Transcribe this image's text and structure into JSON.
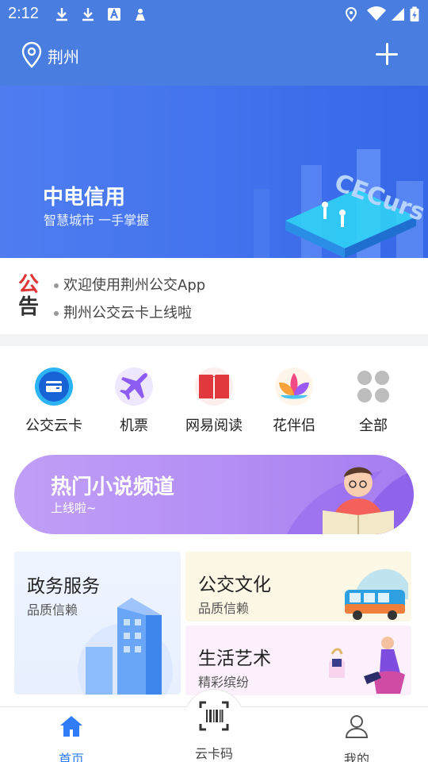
{
  "status_bar": {
    "time": "2:12"
  },
  "header": {
    "city": "荆州"
  },
  "banner": {
    "title": "中电信用",
    "subtitle": "智慧城市  一手掌握",
    "art_text": "CECurs"
  },
  "notice": {
    "badge_top": "公",
    "badge_bottom": "告",
    "items": [
      "欢迎使用荆州公交App",
      "荆州公交云卡上线啦"
    ]
  },
  "quick_menu": [
    {
      "label": "公交云卡",
      "icon": "bus-card-icon"
    },
    {
      "label": "机票",
      "icon": "airplane-icon"
    },
    {
      "label": "网易阅读",
      "icon": "book-icon"
    },
    {
      "label": "花伴侣",
      "icon": "flower-icon"
    },
    {
      "label": "全部",
      "icon": "grid-icon"
    }
  ],
  "promo": {
    "title": "热门小说频道",
    "subtitle": "上线啦~"
  },
  "cards": {
    "gov": {
      "title": "政务服务",
      "subtitle": "品质信赖"
    },
    "bus_culture": {
      "title": "公交文化",
      "subtitle": "品质信赖"
    },
    "life_art": {
      "title": "生活艺术",
      "subtitle": "精彩缤纷"
    }
  },
  "bottom_nav": [
    {
      "label": "首页",
      "active": true
    },
    {
      "label": "云卡码",
      "active": false
    },
    {
      "label": "我的",
      "active": false
    }
  ],
  "colors": {
    "primary": "#4a7de0",
    "active_tab": "#2f7cf6",
    "promo": "#b28cf4"
  }
}
